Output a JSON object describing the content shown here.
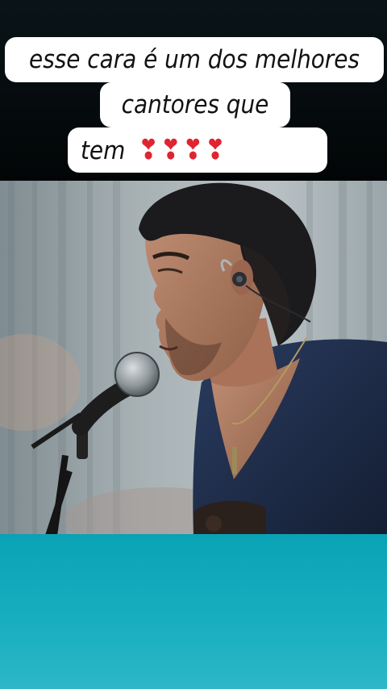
{
  "caption": {
    "line1": "esse cara é um dos melhores",
    "line2": "cantores que",
    "line3_text": "tem",
    "line3_hearts": "❣❣❣❣"
  },
  "video": {
    "subject": "singer-performing",
    "colors": {
      "backdrop": "#8f9aa0",
      "shirt": "#1e2c4a"
    }
  },
  "bottom_panel": {
    "color": "#0aa2b5"
  }
}
